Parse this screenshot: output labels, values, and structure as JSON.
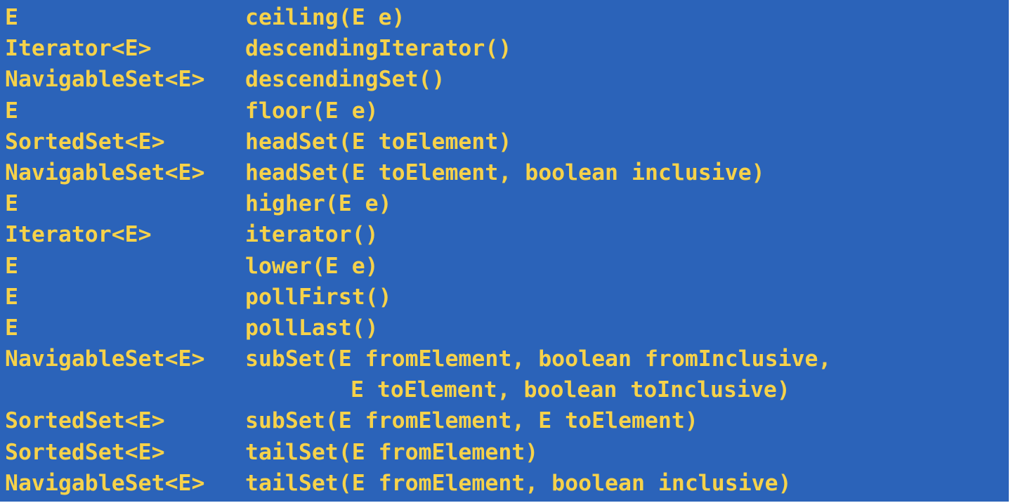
{
  "methods": [
    {
      "return_type": "E",
      "signature": "ceiling(E e)"
    },
    {
      "return_type": "Iterator<E>",
      "signature": "descendingIterator()"
    },
    {
      "return_type": "NavigableSet<E>",
      "signature": "descendingSet()"
    },
    {
      "return_type": "E",
      "signature": "floor(E e)"
    },
    {
      "return_type": "SortedSet<E>",
      "signature": "headSet(E toElement)"
    },
    {
      "return_type": "NavigableSet<E>",
      "signature": "headSet(E toElement, boolean inclusive)"
    },
    {
      "return_type": "E",
      "signature": "higher(E e)"
    },
    {
      "return_type": "Iterator<E>",
      "signature": "iterator()"
    },
    {
      "return_type": "E",
      "signature": "lower(E e)"
    },
    {
      "return_type": "E",
      "signature": "pollFirst()"
    },
    {
      "return_type": "E",
      "signature": "pollLast()"
    },
    {
      "return_type": "NavigableSet<E>",
      "signature": "subSet(E fromElement, boolean fromInclusive,",
      "continuation": "E toElement, boolean toInclusive)"
    },
    {
      "return_type": "SortedSet<E>",
      "signature": "subSet(E fromElement, E toElement)"
    },
    {
      "return_type": "SortedSet<E>",
      "signature": "tailSet(E fromElement)"
    },
    {
      "return_type": "NavigableSet<E>",
      "signature": "tailSet(E fromElement, boolean inclusive)"
    }
  ],
  "colors": {
    "background": "#2b63b9",
    "text": "#f6d24a"
  }
}
